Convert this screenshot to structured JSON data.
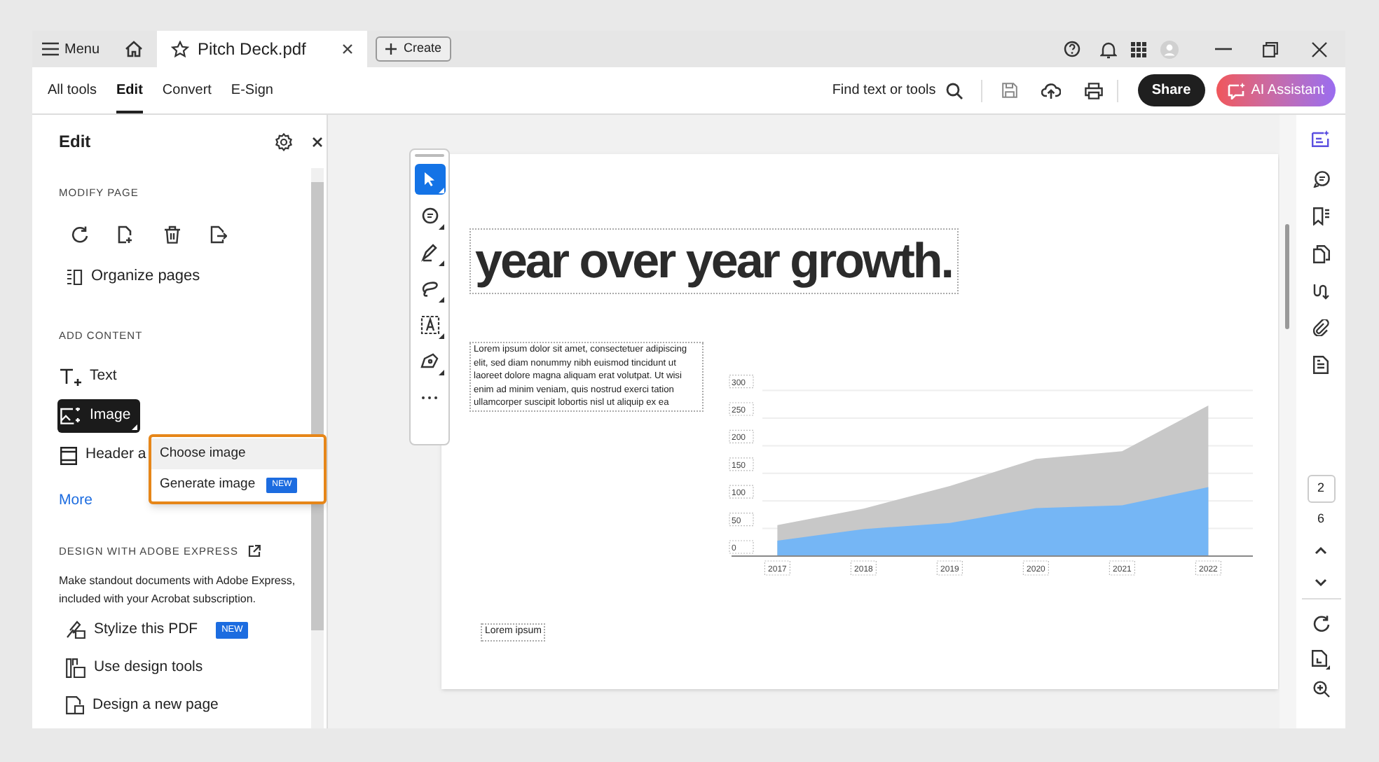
{
  "title_bar": {
    "menu": "Menu",
    "tab": {
      "title": "Pitch Deck.pdf"
    },
    "create": "Create"
  },
  "toolbar": {
    "tabs": [
      {
        "label": "All tools",
        "selected": false
      },
      {
        "label": "Edit",
        "selected": true
      },
      {
        "label": "Convert",
        "selected": false
      },
      {
        "label": "E-Sign",
        "selected": false
      }
    ],
    "search": "Find text or tools",
    "share": "Share",
    "ai_assistant": "AI Assistant"
  },
  "panel": {
    "title": "Edit",
    "modify_page": {
      "heading": "MODIFY PAGE",
      "organize": "Organize pages"
    },
    "add_content": {
      "heading": "ADD CONTENT",
      "items": [
        {
          "label": "Text",
          "selected": false
        },
        {
          "label": "Image",
          "selected": true
        },
        {
          "label": "Header a",
          "selected": false
        }
      ],
      "more": "More"
    },
    "image_menu": [
      {
        "label": "Choose image",
        "selected": true
      },
      {
        "label": "Generate image",
        "selected": false,
        "badge": "NEW"
      }
    ],
    "express": {
      "heading": "DESIGN WITH ADOBE EXPRESS",
      "description": "Make standout documents with Adobe Express, included with your Acrobat subscription.",
      "items": [
        {
          "label": "Stylize this PDF",
          "badge": "NEW"
        },
        {
          "label": "Use design tools"
        },
        {
          "label": "Design a new page"
        }
      ]
    }
  },
  "floating_tools": [
    {
      "selected": true
    },
    {
      "selected": false
    },
    {
      "selected": false
    },
    {
      "selected": false
    },
    {
      "selected": false
    },
    {
      "selected": false
    },
    {
      "selected": false
    }
  ],
  "document": {
    "heading": "year over year growth.",
    "body": "Lorem ipsum dolor sit amet, consectetuer adipiscing elit, sed diam nonummy nibh euismod tincidunt ut laoreet dolore magna aliquam erat volutpat. Ut wisi enim ad minim veniam, quis nostrud exerci tation ullamcorper suscipit lobortis nisl ut aliquip ex ea",
    "caption": "Lorem ipsum",
    "chart_data": {
      "type": "area",
      "categories": [
        "2017",
        "2018",
        "2019",
        "2020",
        "2021",
        "2022"
      ],
      "stacked": false,
      "grid": true,
      "ylim": [
        0,
        300
      ],
      "yticks": [
        0,
        50,
        100,
        150,
        200,
        250,
        300
      ],
      "series": [
        {
          "color": "#c8c8c8",
          "values": [
            56,
            86,
            127,
            176,
            190,
            273
          ]
        },
        {
          "color": "#75b6f5",
          "values": [
            28,
            49,
            60,
            87,
            92,
            125
          ]
        }
      ]
    }
  },
  "page_nav": {
    "current": "2",
    "total": "6"
  }
}
